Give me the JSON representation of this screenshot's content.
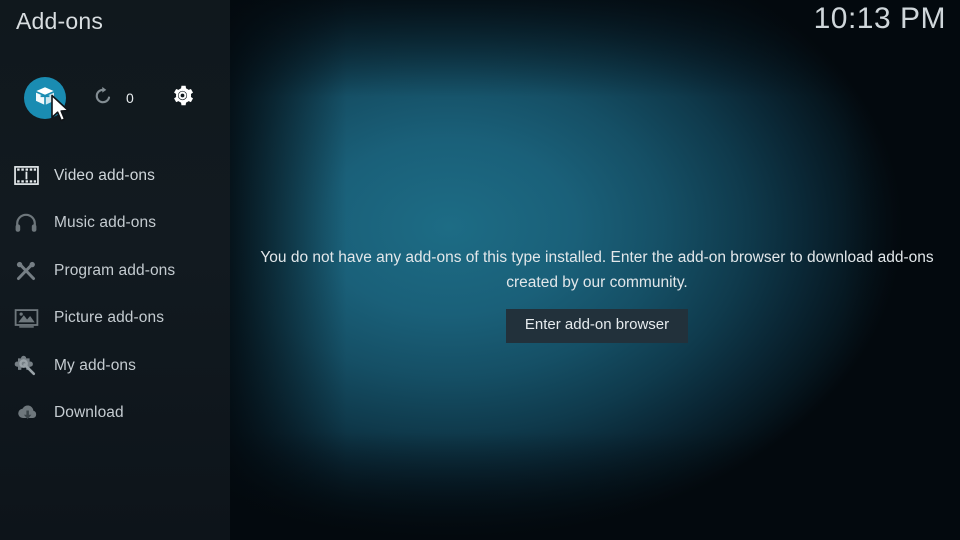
{
  "window": {
    "title": "Add-ons",
    "clock": "10:13 PM"
  },
  "toolbar": {
    "addon_browser": {
      "icon": "package-box-icon",
      "label": "",
      "accent_color": "#1a8cb2"
    },
    "refresh": {
      "icon": "refresh-icon",
      "count": "0"
    },
    "settings": {
      "icon": "gear-icon"
    }
  },
  "sidebar": {
    "items": [
      {
        "label": "Video add-ons",
        "icon": "film-strip-icon"
      },
      {
        "label": "Music add-ons",
        "icon": "headphones-icon"
      },
      {
        "label": "Program add-ons",
        "icon": "crossed-tools-icon"
      },
      {
        "label": "Picture add-ons",
        "icon": "photo-frame-icon"
      },
      {
        "label": "My add-ons",
        "icon": "puzzle-wrench-icon"
      },
      {
        "label": "Download",
        "icon": "cloud-download-icon"
      }
    ]
  },
  "main": {
    "empty_message": "You do not have any add-ons of this type installed. Enter the add-on browser to download add-ons created by our community.",
    "enter_browser_label": "Enter add-on browser"
  },
  "colors": {
    "accent": "#1a8cb2",
    "sidebar_bg": "#121a20",
    "main_bg": "#1a6079",
    "button_bg": "#22313b",
    "text": "#d8dde0"
  }
}
